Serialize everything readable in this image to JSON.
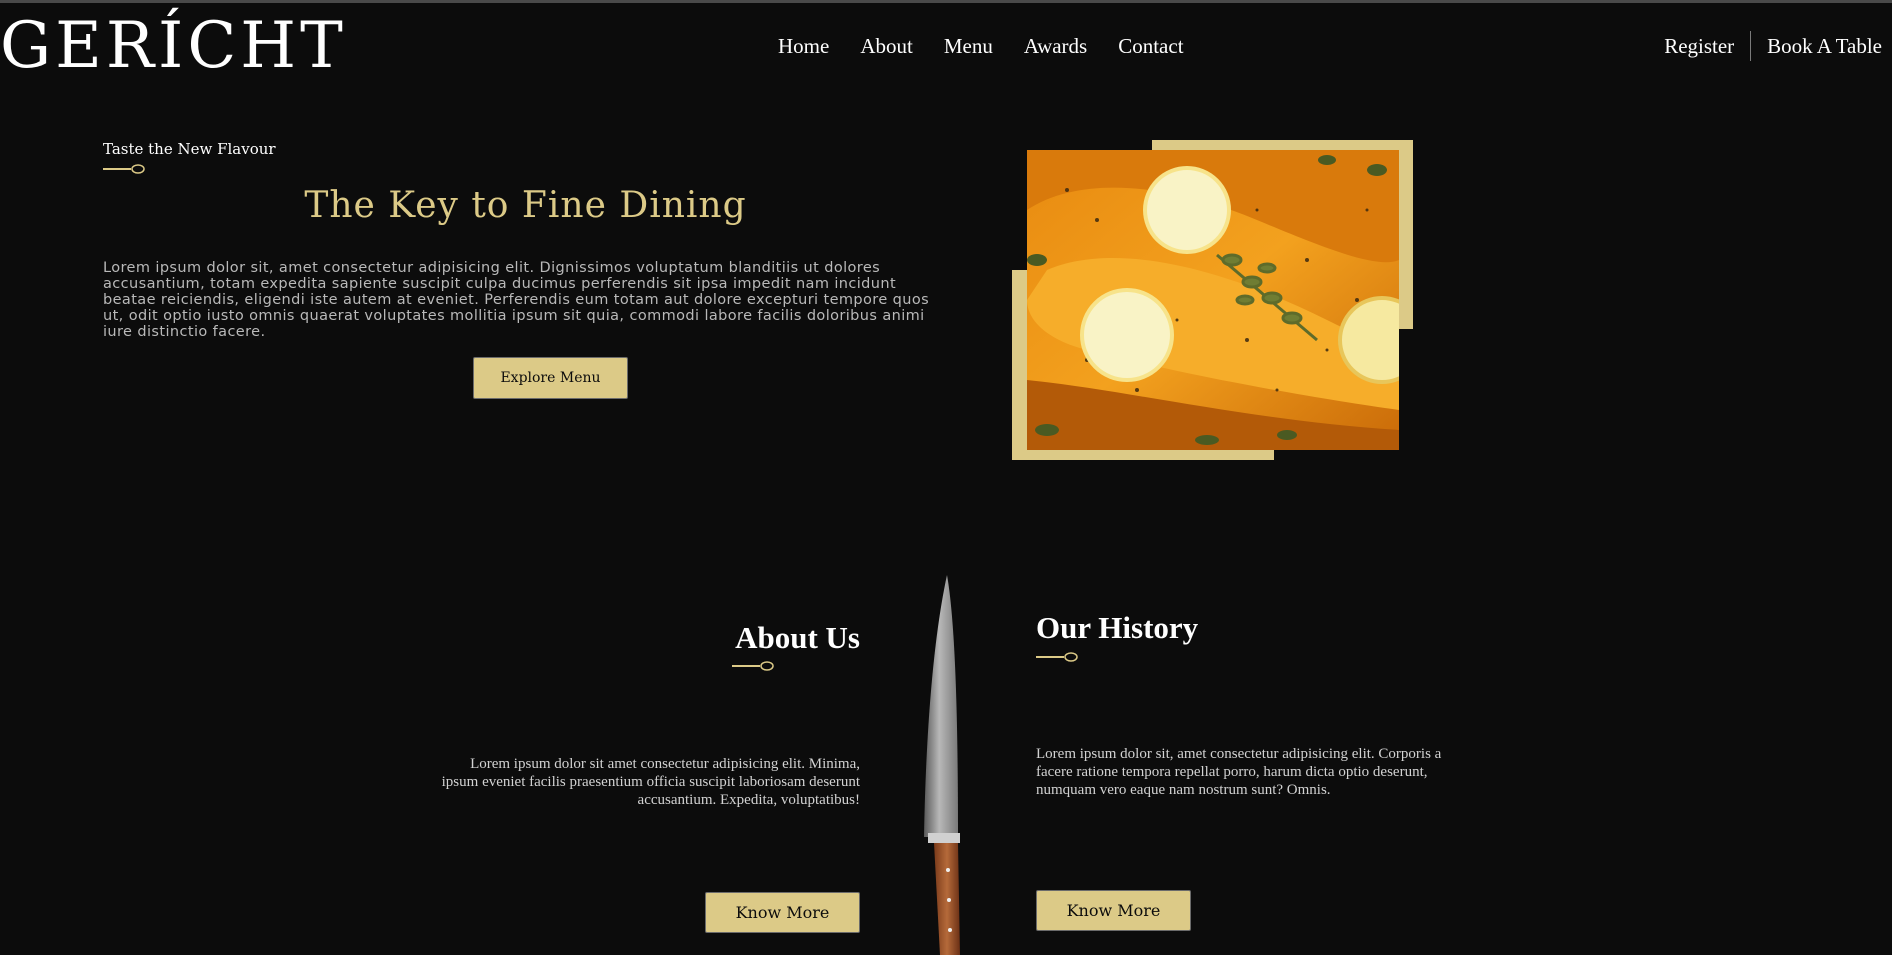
{
  "navbar": {
    "logo": "GERÍCHT",
    "links": [
      "Home",
      "About",
      "Menu",
      "Awards",
      "Contact"
    ],
    "register": "Register",
    "book_table": "Book A Table"
  },
  "hero": {
    "subtitle": "Taste the New Flavour",
    "title": "The Key to Fine Dining",
    "text": "Lorem ipsum dolor sit, amet consectetur adipisicing elit. Dignissimos voluptatum blanditiis ut dolores accusantium, totam expedita sapiente suscipit culpa ducimus perferendis sit ipsa impedit nam incidunt beatae reiciendis, eligendi iste autem at eveniet. Perferendis eum totam aut dolore excepturi tempore quos ut, odit optio iusto omnis quaerat voluptates mollitia ipsum sit quia, commodi labore facilis doloribus animi iure distinctio facere.",
    "button": "Explore Menu"
  },
  "about": {
    "title": "About Us",
    "text": "Lorem ipsum dolor sit amet consectetur adipisicing elit. Minima, ipsum eveniet facilis praesentium officia suscipit laboriosam deserunt accusantium. Expedita, voluptatibus!",
    "button": "Know More"
  },
  "history": {
    "title": "Our History",
    "text": "Lorem ipsum dolor sit, amet consectetur adipisicing elit. Corporis a facere ratione tempora repellat porro, harum dicta optio deserunt, numquam vero eaque nam nostrum sunt? Omnis.",
    "button": "Know More"
  },
  "colors": {
    "background": "#0c0c0c",
    "accent_gold": "#dcca87",
    "text_gray": "#b9b9b9"
  }
}
